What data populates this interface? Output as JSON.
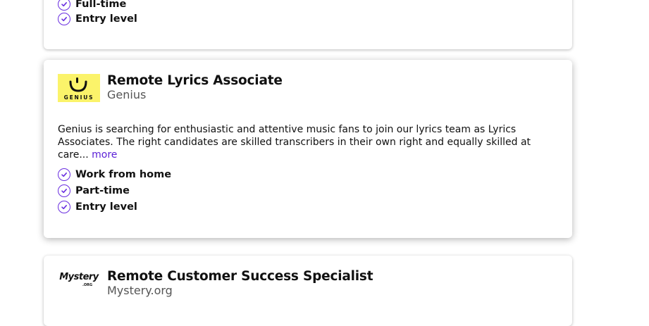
{
  "cards": [
    {
      "features": [
        "Full-time",
        "Entry level"
      ]
    },
    {
      "title": "Remote Lyrics Associate",
      "company": "Genius",
      "logo_text": "GENIUS",
      "description": "Genius is searching for enthusiastic and attentive music fans to join our lyrics team as Lyrics Associates. The right candidates are skilled transcribers in their own right and equally skilled at care...",
      "more_label": "more",
      "features": [
        "Work from home",
        "Part-time",
        "Entry level"
      ]
    },
    {
      "title": "Remote Customer Success Specialist",
      "company": "Mystery.org",
      "logo_text": "Mystery",
      "logo_subtext": ".ORG"
    }
  ],
  "colors": {
    "accent": "#6a2ee0",
    "link": "#5a1fd6",
    "genius_logo_bg": "#fbf36a"
  },
  "icons": {
    "feature": "check-circle-icon"
  }
}
